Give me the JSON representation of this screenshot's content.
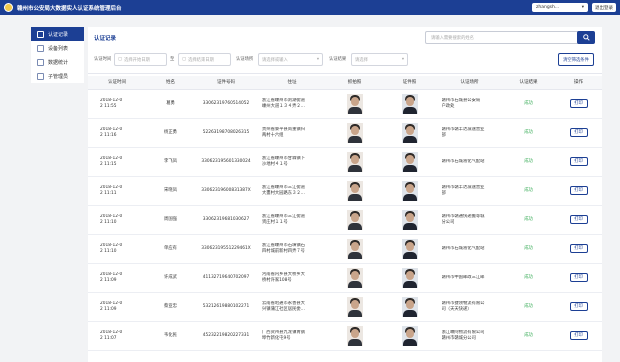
{
  "topbar": {
    "title": "赣州市公安局大数据实人认证系统管理后台",
    "user": "zhangsh...",
    "logout": "退出登录"
  },
  "sidebar": {
    "items": [
      {
        "label": "认证记录",
        "icon": "record-icon"
      },
      {
        "label": "设备列表",
        "icon": "device-icon"
      },
      {
        "label": "数据统计",
        "icon": "chart-icon"
      },
      {
        "label": "子管理员",
        "icon": "admin-icon"
      }
    ]
  },
  "main": {
    "title": "认证记录",
    "search_placeholder": "请输入需要搜索的姓名",
    "filters": {
      "time_label": "认证时间",
      "time_start": "选择开始日期",
      "to": "至",
      "time_end": "选择结束日期",
      "place_label": "认证场所",
      "place_placeholder": "请选择或输入",
      "result_label": "认证结果",
      "result_placeholder": "请选择",
      "clear": "清空筛选条件"
    },
    "columns": [
      "认证时间",
      "姓名",
      "证件号码",
      "住址",
      "抓拍照",
      "证件照",
      "认证场所",
      "认证结果",
      "操作"
    ],
    "rows": [
      {
        "time": "2018-12-0\n2 11:55",
        "name": "葛勇",
        "id": "33062319760514052",
        "addr": "浙江省嵊州市剡湖街道\n嵊州大道１３４弄２…",
        "place": "赣州市石城县公安局\n户政处",
        "result": "成功",
        "action": "打印"
      },
      {
        "time": "2018-12-0\n2 11:16",
        "name": "杨正勇",
        "id": "52263198708026315",
        "addr": "贵州省黎平县尚重镇归\n两村十六组",
        "place": "赣州市赣丰达减速营业\n部",
        "result": "成功",
        "action": "打印"
      },
      {
        "time": "2018-12-0\n2 11:15",
        "name": "李飞凤",
        "id": "330623195601330024",
        "addr": "浙江省嵊州市甘霖镇下\n沙地村４１号",
        "place": "赣州市石城液化气配站",
        "result": "成功",
        "action": "打印"
      },
      {
        "time": "2018-12-0\n2 11:11",
        "name": "宋晓凤",
        "id": "33062319600831387X",
        "addr": "浙江省嵊州市三江街道\n大畫村大园路东３２…",
        "place": "赣州市赣丰达减速营业\n部",
        "result": "成功",
        "action": "打印"
      },
      {
        "time": "2018-12-0\n2 11:10",
        "name": "周国强",
        "id": "33062319681030627",
        "addr": "浙江省嵊州市三江街道\n贤庄村１１号",
        "place": "赣州市赣通快递搬等城\n分公司",
        "result": "成功",
        "action": "打印"
      },
      {
        "time": "2018-12-0\n2 11:10",
        "name": "单应有",
        "id": "33062319551229461X",
        "addr": "浙江省嵊州市石璜镇石\n四村城前新村四弄７号",
        "place": "赣州市石城液化气配站",
        "result": "成功",
        "action": "打印"
      },
      {
        "time": "2018-12-0\n2 11:09",
        "name": "许成武",
        "id": "41132719640702097",
        "addr": "河南省内乡县大桥乡大\n桥村许家108号",
        "place": "赣州市中国邮政三江邮",
        "result": "成功",
        "action": "打印"
      },
      {
        "time": "2018-12-0\n2 11:09",
        "name": "蔡亚忠",
        "id": "53212619880102271",
        "addr": "云南省昭通市永善县大\n兴镇蒲江社区居民委…",
        "place": "赣州市捷领物流有限公\n司（天天快递）",
        "result": "成功",
        "action": "打印"
      },
      {
        "time": "2018-12-0\n2 11:07",
        "name": "韦化民",
        "id": "45232219820227331",
        "addr": "广西贺州县九龙镇青钢\n埠竹新化屯9号",
        "place": "浙江嵊阿物流有限公司\n赣州市赣城分公司",
        "result": "成功",
        "action": "打印"
      }
    ]
  }
}
